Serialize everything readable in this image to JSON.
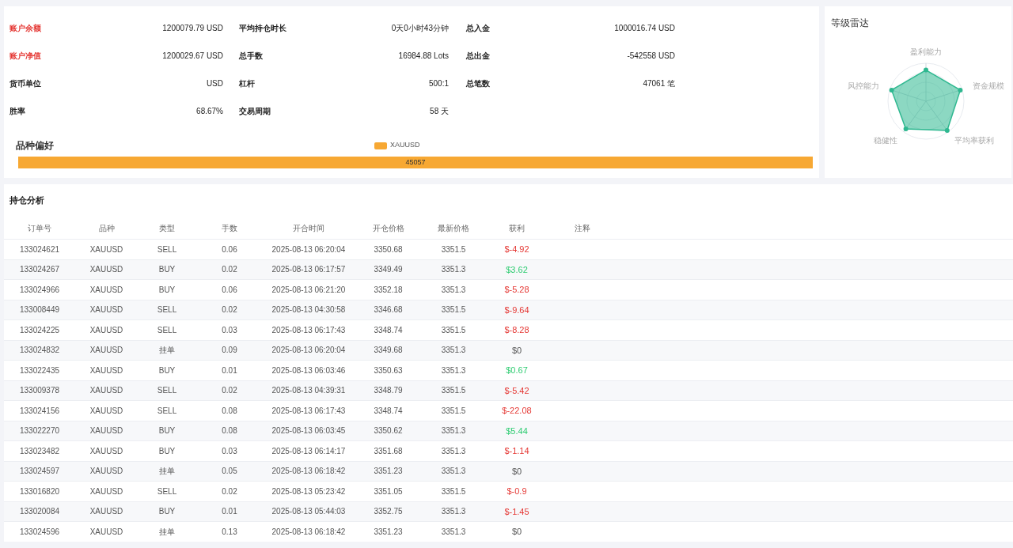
{
  "stats": [
    {
      "label": "账户余额",
      "value": "1200079.79 USD",
      "highlight": true
    },
    {
      "label": "平均持仓时长",
      "value": "0天0小时43分钟",
      "highlight": false
    },
    {
      "label": "总入金",
      "value": "1000016.74 USD",
      "highlight": false
    },
    {
      "label": "账户净值",
      "value": "1200029.67 USD",
      "highlight": true
    },
    {
      "label": "总手数",
      "value": "16984.88 Lots",
      "highlight": false
    },
    {
      "label": "总出金",
      "value": "-542558 USD",
      "highlight": false
    },
    {
      "label": "货币单位",
      "value": "USD",
      "highlight": false
    },
    {
      "label": "杠杆",
      "value": "500:1",
      "highlight": false
    },
    {
      "label": "总笔数",
      "value": "47061 笔",
      "highlight": false
    },
    {
      "label": "胜率",
      "value": "68.67%",
      "highlight": false
    },
    {
      "label": "交易周期",
      "value": "58 天",
      "highlight": false
    }
  ],
  "preference": {
    "title": "品种偏好",
    "legend": "XAUUSD",
    "bar_label": "45057",
    "level": 1
  },
  "radar": {
    "title": "等级雷达",
    "axes": [
      "盈利能力",
      "资金规模",
      "平均率获利",
      "稳健性",
      "风控能力"
    ]
  },
  "positions": {
    "title": "持仓分析",
    "columns": [
      "订单号",
      "品种",
      "类型",
      "手数",
      "开合时间",
      "开仓价格",
      "最新价格",
      "获利",
      "注释"
    ],
    "rows": [
      {
        "cells": [
          "133024621",
          "XAUUSD",
          "SELL",
          "0.06",
          "2025-08-13 06:20:04",
          "3350.68",
          "3351.5",
          "$-4.92"
        ],
        "color": "#e53935"
      },
      {
        "cells": [
          "133024267",
          "XAUUSD",
          "BUY",
          "0.02",
          "2025-08-13 06:17:57",
          "3349.49",
          "3351.3",
          "$3.62"
        ],
        "color": "#2ecc71"
      },
      {
        "cells": [
          "133024966",
          "XAUUSD",
          "BUY",
          "0.06",
          "2025-08-13 06:21:20",
          "3352.18",
          "3351.3",
          "$-5.28"
        ],
        "color": "#e53935"
      },
      {
        "cells": [
          "133008449",
          "XAUUSD",
          "SELL",
          "0.02",
          "2025-08-13 04:30:58",
          "3346.68",
          "3351.5",
          "$-9.64"
        ],
        "color": "#e53935"
      },
      {
        "cells": [
          "133024225",
          "XAUUSD",
          "SELL",
          "0.03",
          "2025-08-13 06:17:43",
          "3348.74",
          "3351.5",
          "$-8.28"
        ],
        "color": "#e53935"
      },
      {
        "cells": [
          "133024832",
          "XAUUSD",
          "挂单",
          "0.09",
          "2025-08-13 06:20:04",
          "3349.68",
          "3351.3",
          "$0"
        ]
      },
      {
        "cells": [
          "133022435",
          "XAUUSD",
          "BUY",
          "0.01",
          "2025-08-13 06:03:46",
          "3350.63",
          "3351.3",
          "$0.67"
        ],
        "color": "#2ecc71"
      },
      {
        "cells": [
          "133009378",
          "XAUUSD",
          "SELL",
          "0.02",
          "2025-08-13 04:39:31",
          "3348.79",
          "3351.5",
          "$-5.42"
        ],
        "color": "#e53935"
      },
      {
        "cells": [
          "133024156",
          "XAUUSD",
          "SELL",
          "0.08",
          "2025-08-13 06:17:43",
          "3348.74",
          "3351.5",
          "$-22.08"
        ],
        "color": "#e53935"
      },
      {
        "cells": [
          "133022270",
          "XAUUSD",
          "BUY",
          "0.08",
          "2025-08-13 06:03:45",
          "3350.62",
          "3351.3",
          "$5.44"
        ],
        "color": "#2ecc71"
      },
      {
        "cells": [
          "133023482",
          "XAUUSD",
          "BUY",
          "0.03",
          "2025-08-13 06:14:17",
          "3351.68",
          "3351.3",
          "$-1.14"
        ],
        "color": "#e53935"
      },
      {
        "cells": [
          "133024597",
          "XAUUSD",
          "挂单",
          "0.05",
          "2025-08-13 06:18:42",
          "3351.23",
          "3351.3",
          "$0"
        ]
      },
      {
        "cells": [
          "133016820",
          "XAUUSD",
          "SELL",
          "0.02",
          "2025-08-13 05:23:42",
          "3351.05",
          "3351.5",
          "$-0.9"
        ],
        "color": "#e53935"
      },
      {
        "cells": [
          "133020084",
          "XAUUSD",
          "BUY",
          "0.01",
          "2025-08-13 05:44:03",
          "3352.75",
          "3351.3",
          "$-1.45"
        ],
        "color": "#e53935"
      },
      {
        "cells": [
          "133024596",
          "XAUUSD",
          "挂单",
          "0.13",
          "2025-08-13 06:18:42",
          "3351.23",
          "3351.3",
          "$0"
        ]
      }
    ]
  }
}
